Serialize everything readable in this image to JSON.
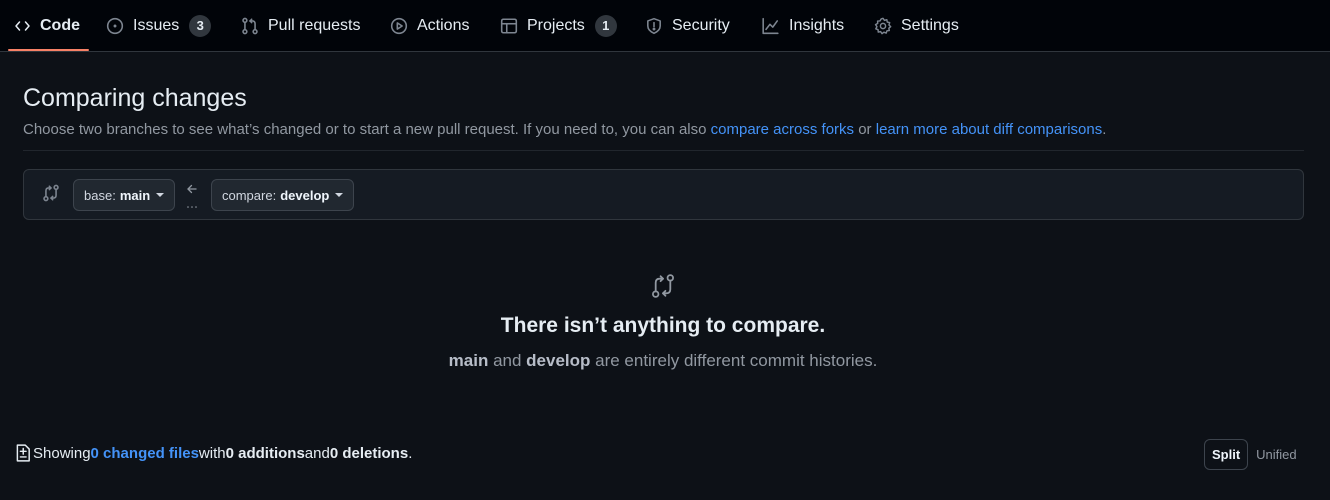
{
  "nav": {
    "tabs": [
      {
        "label": "Code",
        "icon": "code-icon",
        "active": true
      },
      {
        "label": "Issues",
        "icon": "issue-opened-icon",
        "count": "3"
      },
      {
        "label": "Pull requests",
        "icon": "git-pull-request-icon"
      },
      {
        "label": "Actions",
        "icon": "play-icon"
      },
      {
        "label": "Projects",
        "icon": "table-icon",
        "count": "1"
      },
      {
        "label": "Security",
        "icon": "shield-icon"
      },
      {
        "label": "Insights",
        "icon": "graph-icon"
      },
      {
        "label": "Settings",
        "icon": "gear-icon"
      }
    ]
  },
  "header": {
    "title": "Comparing changes",
    "description": "Choose two branches to see what’s changed or to start a new pull request. If you need to, you can also ",
    "link1": "compare across forks",
    "between": " or ",
    "link2": "learn more about diff comparisons",
    "end": "."
  },
  "compare": {
    "base_prefix": "base:",
    "base_branch": "main",
    "compare_prefix": "compare:",
    "compare_branch": "develop"
  },
  "blank_state": {
    "icon": "git-compare-icon",
    "title": "There isn’t anything to compare.",
    "branch_a": "main",
    "and": " and ",
    "branch_b": "develop",
    "rest": " are entirely different commit histories."
  },
  "diff_summary": {
    "icon": "file-diff-icon",
    "showing": "Showing ",
    "changed_files": "0 changed files",
    "with": " with ",
    "additions": "0 additions",
    "and": " and ",
    "deletions": "0 deletions",
    "end": "."
  },
  "view_toggle": {
    "split": "Split",
    "unified": "Unified",
    "selected": "Split"
  },
  "colors": {
    "background": "#0d1117",
    "nav_background": "#010409",
    "active_underline": "#f78166",
    "link": "#4493f8",
    "muted_text": "#9198a1"
  }
}
